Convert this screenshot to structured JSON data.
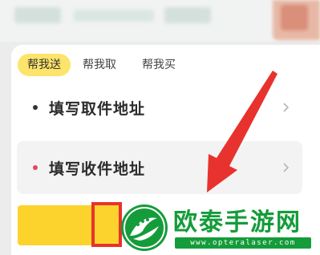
{
  "tabs": [
    {
      "label": "帮我送",
      "active": true
    },
    {
      "label": "帮我取",
      "active": false
    },
    {
      "label": "帮我买",
      "active": false
    }
  ],
  "pickup": {
    "label": "填写取件地址",
    "dot_color": "#333333"
  },
  "delivery": {
    "label": "填写收件地址",
    "dot_color": "#e9455a"
  },
  "colors": {
    "accent_yellow": "#fde46a",
    "button_yellow": "#fcd22c",
    "highlight_red": "#e8322e",
    "arrow_red": "#e8322e",
    "watermark_green": "#149c3a"
  },
  "icons": [
    "chevron-right-icon",
    "annotation-arrow",
    "watermark-logo"
  ],
  "watermark": {
    "title": "欧泰手游网",
    "url": "www.opteralaser.com"
  }
}
